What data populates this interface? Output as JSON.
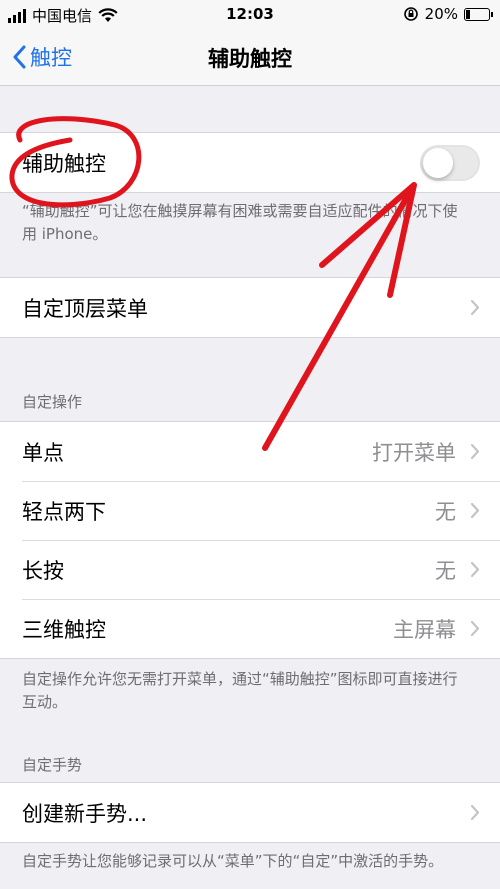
{
  "status_bar": {
    "carrier": "中国电信",
    "time": "12:03",
    "battery_percent": "20%",
    "battery_level": 0.2
  },
  "nav": {
    "back_label": "触控",
    "title": "辅助触控"
  },
  "assistive_touch": {
    "label": "辅助触控",
    "toggle_on": false,
    "footnote": "“辅助触控”可让您在触摸屏幕有困难或需要自适应配件的情况下使用 iPhone。"
  },
  "top_menu": {
    "label": "自定顶层菜单"
  },
  "custom_actions": {
    "header": "自定操作",
    "rows": [
      {
        "label": "单点",
        "value": "打开菜单"
      },
      {
        "label": "轻点两下",
        "value": "无"
      },
      {
        "label": "长按",
        "value": "无"
      },
      {
        "label": "三维触控",
        "value": "主屏幕"
      }
    ],
    "footnote": "自定操作允许您无需打开菜单，通过“辅助触控”图标即可直接进行互动。"
  },
  "custom_gestures": {
    "header": "自定手势",
    "create_label": "创建新手势...",
    "footnote": "自定手势让您能够记录可以从“菜单”下的“自定”中激活的手势。"
  },
  "colors": {
    "accent": "#1f73e8",
    "annotation": "#e0141c",
    "background": "#efeff4"
  },
  "icons": [
    "signal-icon",
    "wifi-icon",
    "orientation-lock-icon",
    "battery-icon",
    "back-chevron-icon",
    "chevron-right-icon"
  ]
}
